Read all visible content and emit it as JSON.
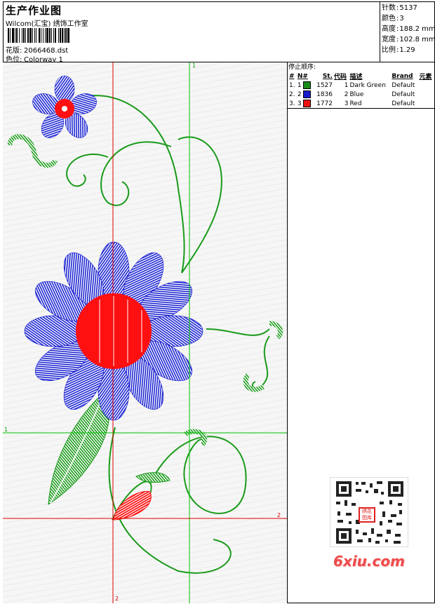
{
  "header": {
    "title": "生产作业图",
    "software": "Wilcom(汇宝) 绣饰工作室",
    "design_label": "花版:",
    "design_file": "2066468.dst",
    "color_label": "色位:",
    "colorway": "Colorway 1"
  },
  "stats": [
    {
      "label": "针数",
      "value": "5137"
    },
    {
      "label": "颜色",
      "value": "3"
    },
    {
      "label": "高度",
      "value": "188.2 mm"
    },
    {
      "label": "宽度",
      "value": "102.8 mm"
    },
    {
      "label": "比例",
      "value": "1.29"
    }
  ],
  "stop_sequence": {
    "title": "停止顺序:",
    "columns": [
      "#",
      "N#",
      "St.",
      "代码",
      "描述",
      "Brand",
      "元素"
    ],
    "rows": [
      {
        "num": "1.",
        "n": "1",
        "color": "#1a8c1a",
        "stitches": "1527",
        "code": "1",
        "description": "Dark Green",
        "brand": "Default"
      },
      {
        "num": "2.",
        "n": "2",
        "color": "#1a1acc",
        "stitches": "1836",
        "code": "2",
        "description": "Blue",
        "brand": "Default"
      },
      {
        "num": "3.",
        "n": "3",
        "color": "#ee1111",
        "stitches": "1772",
        "code": "3",
        "description": "Red",
        "brand": "Default"
      }
    ]
  },
  "guides": {
    "v1_label": "1",
    "v2_label": "2",
    "h1_label": "1",
    "h2_label": "2"
  },
  "watermark": {
    "stamp": "绣花图库",
    "site": "6xiu.com"
  },
  "colors": {
    "guide_red": "#e00000",
    "guide_green": "#00c000",
    "stitch_green": "#1a9a1a",
    "stitch_blue": "#1a22d0",
    "stitch_red": "#ff1010"
  }
}
